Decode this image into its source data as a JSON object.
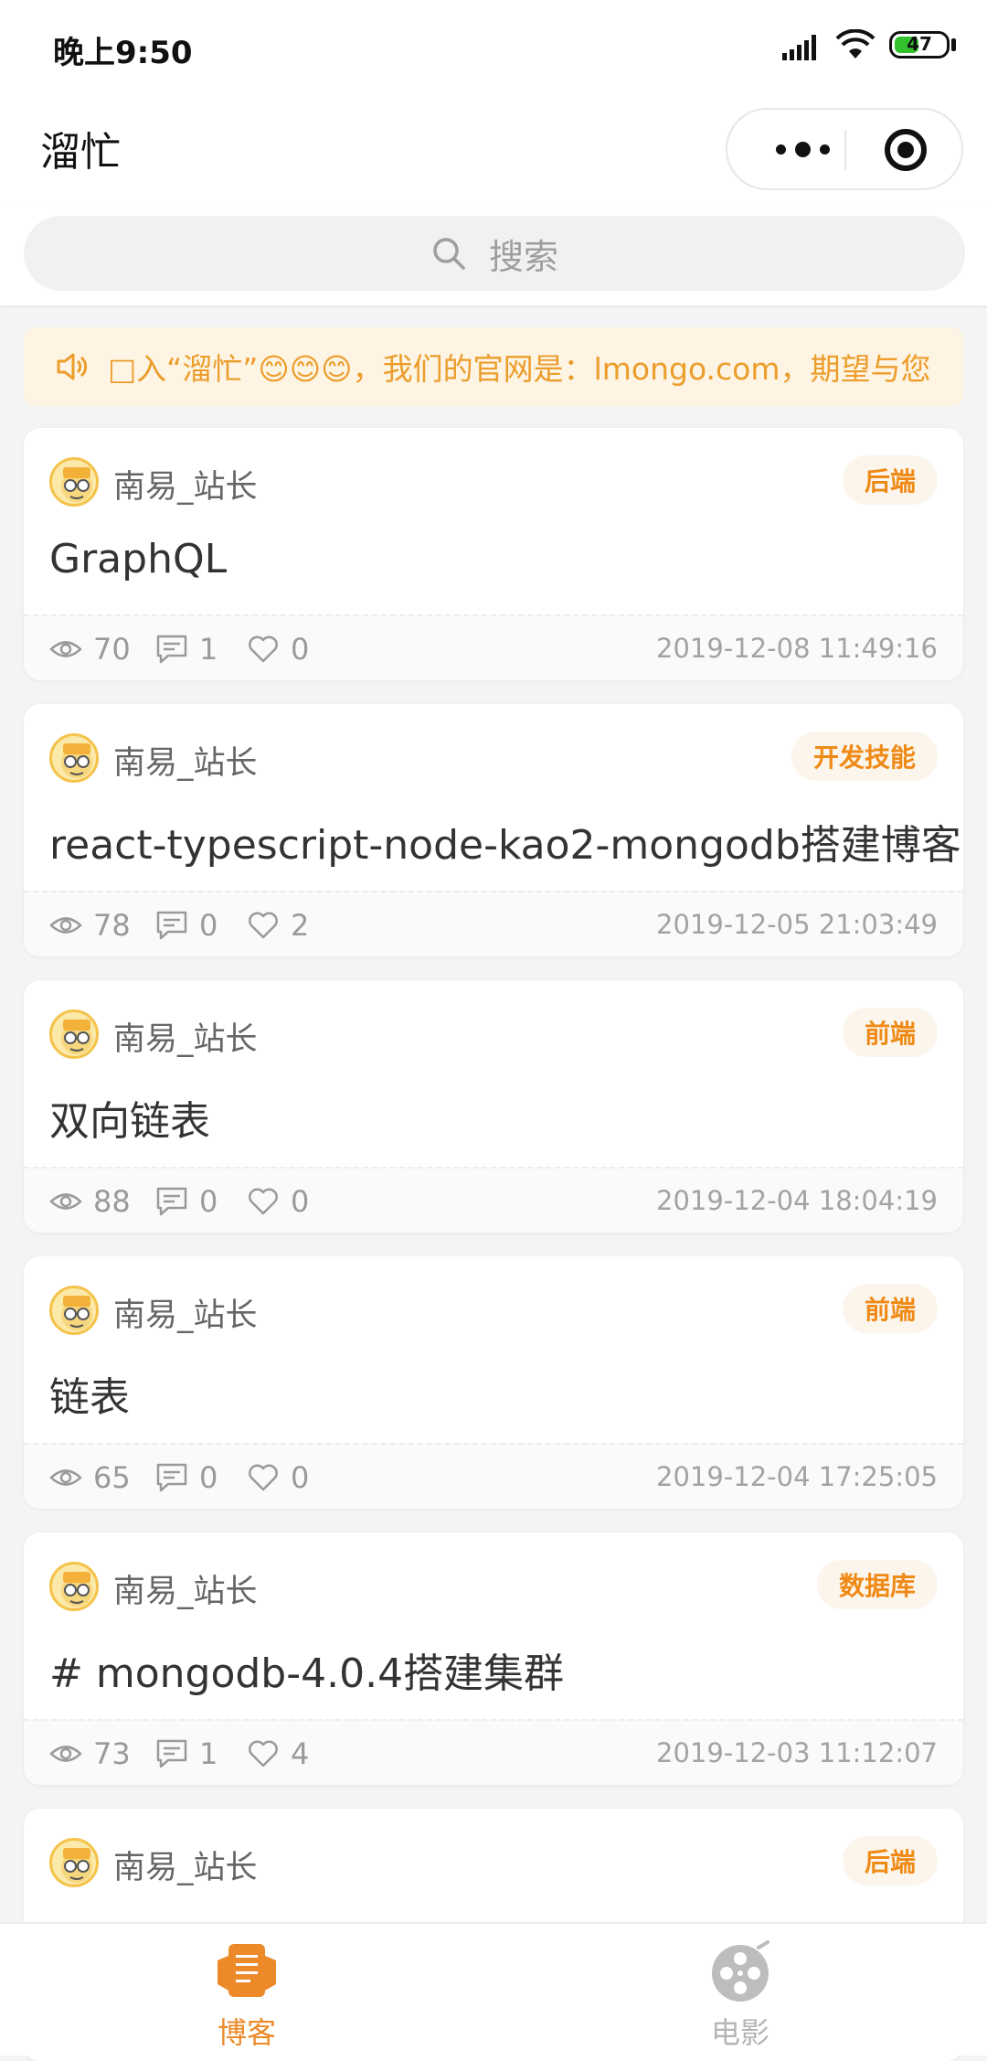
{
  "status_bar": {
    "time": "晚上9:50",
    "battery_level": "47"
  },
  "navbar": {
    "title": "溜忙"
  },
  "search": {
    "placeholder": "搜索"
  },
  "notice": {
    "text": "□入“溜忙”😊😊😊，我们的官网是：lmongo.com，期望与您"
  },
  "posts": [
    {
      "author": "南易_站长",
      "tag": "后端",
      "title": "GraphQL",
      "views": "70",
      "comments": "1",
      "likes": "0",
      "date": "2019-12-08 11:49:16"
    },
    {
      "author": "南易_站长",
      "tag": "开发技能",
      "title": "react-typescript-node-kao2-mongodb搭建博客",
      "views": "78",
      "comments": "0",
      "likes": "2",
      "date": "2019-12-05 21:03:49"
    },
    {
      "author": "南易_站长",
      "tag": "前端",
      "title": "双向链表",
      "views": "88",
      "comments": "0",
      "likes": "0",
      "date": "2019-12-04 18:04:19"
    },
    {
      "author": "南易_站长",
      "tag": "前端",
      "title": "链表",
      "views": "65",
      "comments": "0",
      "likes": "0",
      "date": "2019-12-04 17:25:05"
    },
    {
      "author": "南易_站长",
      "tag": "数据库",
      "title": "# mongodb-4.0.4搭建集群",
      "views": "73",
      "comments": "1",
      "likes": "4",
      "date": "2019-12-03 11:12:07"
    },
    {
      "author": "南易_站长",
      "tag": "后端"
    }
  ],
  "tabbar": {
    "items": [
      {
        "label": "博客",
        "icon": "blog-icon",
        "active": true
      },
      {
        "label": "电影",
        "icon": "film-reel-icon",
        "active": false
      }
    ]
  },
  "colors": {
    "accent": "#ec8a2a",
    "tag_text": "#f08a16",
    "notice_bg": "#fdf4e3",
    "inactive_tab": "#b5b5b5"
  }
}
